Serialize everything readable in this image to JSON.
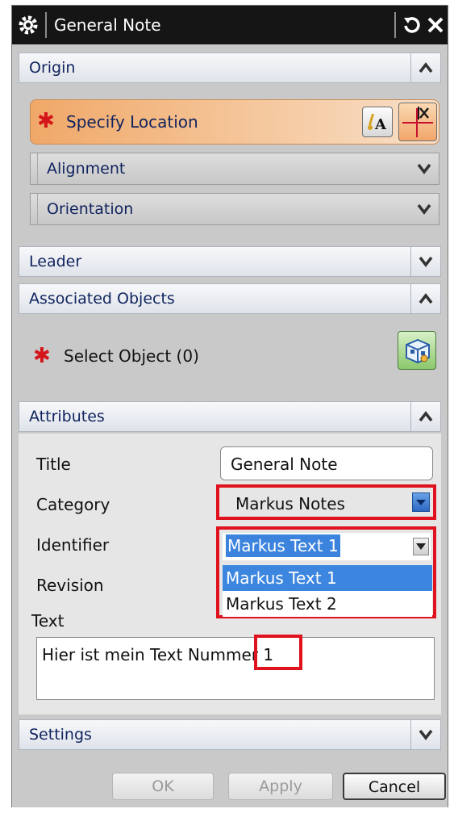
{
  "window": {
    "title": "General Note"
  },
  "sections": {
    "origin": {
      "label": "Origin",
      "specify_location": "Specify Location",
      "alignment": "Alignment",
      "orientation": "Orientation"
    },
    "leader": {
      "label": "Leader"
    },
    "associated_objects": {
      "label": "Associated Objects",
      "select_object": "Select Object (0)"
    },
    "attributes": {
      "label": "Attributes",
      "title_label": "Title",
      "title_value": "General Note",
      "category_label": "Category",
      "category_value": "Markus Notes",
      "identifier_label": "Identifier",
      "identifier_value": "Markus Text 1",
      "identifier_options": [
        "Markus Text 1",
        "Markus Text 2"
      ],
      "revision_label": "Revision",
      "text_label": "Text",
      "text_value": "Hier ist mein Text Nummer 1"
    },
    "settings": {
      "label": "Settings"
    }
  },
  "footer": {
    "ok": "OK",
    "apply": "Apply",
    "cancel": "Cancel"
  },
  "colors": {
    "required_marker": "#d4161b",
    "highlight_box": "#e0121d",
    "selection": "#3b83dd",
    "header_text": "#10235e"
  },
  "icons": {
    "title_gear": "gear-icon",
    "reset": "reset-icon",
    "close": "close-icon",
    "collapse": "chevron-up-icon",
    "expand": "chevron-down-icon",
    "text_select": "text-select-icon",
    "point_dialog": "point-dialog-icon",
    "select_object": "select-object-icon",
    "required": "asterisk-icon"
  }
}
